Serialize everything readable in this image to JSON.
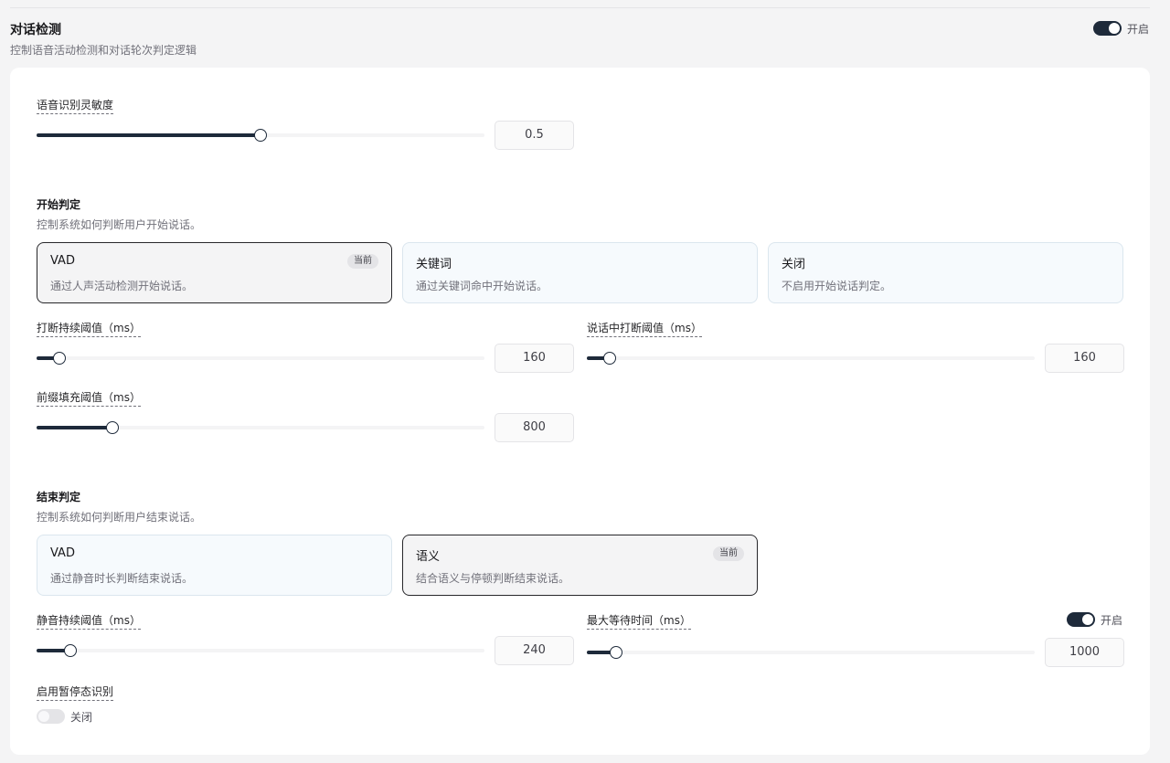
{
  "section": {
    "title": "对话检测",
    "description": "控制语音活动检测和对话轮次判定逻辑",
    "toggle_label": "开启"
  },
  "sensitivity": {
    "label": "语音识别灵敏度",
    "value": "0.5",
    "fraction": 0.5
  },
  "start": {
    "title": "开始判定",
    "description": "控制系统如何判断用户开始说话。",
    "options": [
      {
        "title": "VAD",
        "desc": "通过人声活动检测开始说话。",
        "badge": "当前"
      },
      {
        "title": "关键词",
        "desc": "通过关键词命中开始说话。"
      },
      {
        "title": "关闭",
        "desc": "不启用开始说话判定。"
      }
    ],
    "interrupt_duration": {
      "label": "打断持续阈值（ms）",
      "value": "160",
      "fraction": 0.05
    },
    "speaking_interrupt": {
      "label": "说话中打断阈值（ms）",
      "value": "160",
      "fraction": 0.05
    },
    "prefix_padding": {
      "label": "前缀填充阈值（ms）",
      "value": "800",
      "fraction": 0.17
    }
  },
  "end": {
    "title": "结束判定",
    "description": "控制系统如何判断用户结束说话。",
    "options": [
      {
        "title": "VAD",
        "desc": "通过静音时长判断结束说话。"
      },
      {
        "title": "语义",
        "desc": "结合语义与停顿判断结束说话。",
        "badge": "当前"
      }
    ],
    "silence_duration": {
      "label": "静音持续阈值（ms）",
      "value": "240",
      "fraction": 0.075
    },
    "max_wait": {
      "label": "最大等待时间（ms）",
      "value": "1000",
      "fraction": 0.065,
      "toggle_label": "开启"
    },
    "pause_detection": {
      "label": "启用暂停态识别",
      "toggle_label": "关闭"
    }
  }
}
